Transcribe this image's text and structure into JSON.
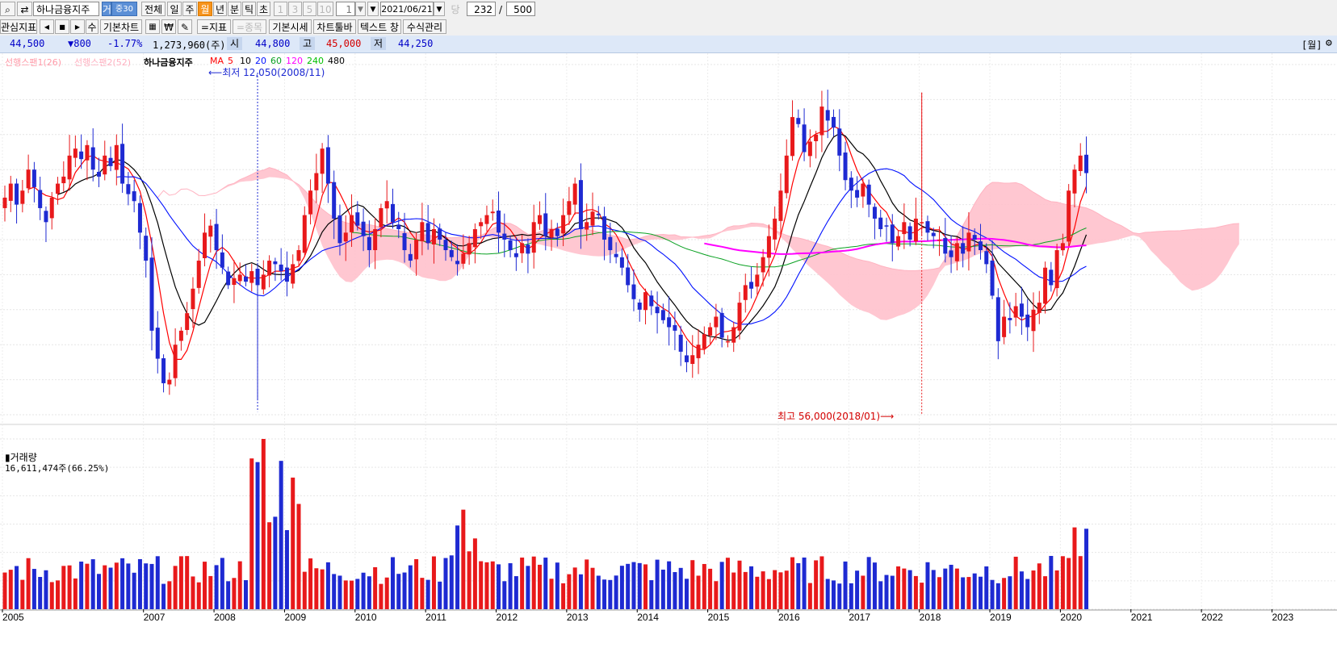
{
  "toolbar": {
    "stock_name": "하나금융지주",
    "badge_trade": "거",
    "badge_group": "중30",
    "periods": [
      "전체",
      "일",
      "주",
      "월",
      "년",
      "분",
      "틱",
      "초"
    ],
    "period_active": "월",
    "interval_buttons": [
      "1",
      "3",
      "5",
      "10"
    ],
    "interval_value": "1",
    "date": "2021/06/21",
    "count_label": "당",
    "count_value": "232",
    "count_sep": "/",
    "count_total": "500"
  },
  "toolbar2": {
    "interest": "관심지표",
    "nav": [
      "◀",
      "■",
      "▶"
    ],
    "su": "수",
    "basic_chart": "기본차트",
    "won": "₩",
    "indicator": "=지표",
    "stock": "=종목",
    "basic_quote": "기본시세",
    "chart_toolbar": "차트툴바",
    "text_window": "텍스트 창",
    "formula": "수식관리"
  },
  "quote": {
    "price": "44,500",
    "change": "▼800",
    "change_pct": "-1.77%",
    "volume": "1,273,960(주)",
    "open_label": "시",
    "open": "44,800",
    "high_label": "고",
    "high": "45,000",
    "low_label": "저",
    "low": "44,250",
    "period_tag": "[월]"
  },
  "legend": {
    "span1": "선행스팬1(26)",
    "span2": "선행스팬2(52)",
    "name": "하나금융지주",
    "ma_label": "MA",
    "ma_periods": [
      "5",
      "10",
      "20",
      "60",
      "120",
      "240",
      "480"
    ]
  },
  "colors": {
    "up": "#e8191b",
    "down": "#1e2ad2",
    "ma5": "#ff0000",
    "ma10": "#000000",
    "ma20": "#0010ff",
    "ma60": "#08a020",
    "ma120": "#ff00ff",
    "ma240": "#00c000",
    "ma480": "#000000",
    "cloud": "#ffc1cc",
    "span1": "#ff8fa3",
    "span2": "#ffb3c1"
  },
  "annotations": {
    "low": "최저 12,050(2008/11)",
    "high": "최고 56,000(2018/01)"
  },
  "volume": {
    "title": "거래량",
    "value": "16,611,474주(66.25%)"
  },
  "chart_data": {
    "type": "candlestick",
    "interval": "monthly",
    "xaxis_labels": [
      "2005",
      "2007",
      "2008",
      "2009",
      "2010",
      "2011",
      "2012",
      "2013",
      "2014",
      "2015",
      "2016",
      "2017",
      "2018",
      "2019",
      "2020",
      "2021",
      "2022",
      "2023"
    ],
    "price_range": [
      10000,
      60000
    ],
    "closes": [
      41000,
      43000,
      40000,
      42000,
      45000,
      42500,
      39500,
      37500,
      41000,
      43000,
      44000,
      47000,
      48000,
      46500,
      48500,
      45000,
      44000,
      47000,
      45500,
      48500,
      43000,
      41500,
      40500,
      36000,
      32000,
      22000,
      18000,
      14500,
      15000,
      20000,
      22000,
      24500,
      28000,
      32000,
      36000,
      37000,
      33500,
      31000,
      28500,
      29500,
      30000,
      29000,
      30500,
      28500,
      30000,
      32000,
      31500,
      30500,
      29000,
      31500,
      33500,
      38500,
      42000,
      44500,
      48000,
      43000,
      38000,
      34500,
      36000,
      38500,
      37000,
      35500,
      33500,
      36500,
      39500,
      40500,
      37500,
      36500,
      33500,
      32000,
      35000,
      37500,
      34500,
      36500,
      35000,
      33500,
      32500,
      31500,
      33000,
      34500,
      36500,
      37500,
      38500,
      39000,
      36000,
      35000,
      33500,
      32500,
      34500,
      33000,
      37500,
      38500,
      35500,
      36500,
      35500,
      38500,
      40500,
      43000,
      36500,
      37500,
      39000,
      38500,
      35000,
      33500,
      32500,
      31000,
      28500,
      26500,
      25000,
      27500,
      25500,
      24500,
      23500,
      22500,
      22000,
      19000,
      17500,
      18500,
      20000,
      21500,
      22500,
      24000,
      21000,
      20500,
      22500,
      26000,
      28500,
      28000,
      30000,
      32500,
      35500,
      38000,
      42000,
      47000,
      52500,
      51500,
      47500,
      49000,
      50000,
      54000,
      52000,
      51000,
      47000,
      43500,
      42000,
      41000,
      43000,
      40000,
      38000,
      36500,
      37000,
      34500,
      35500,
      37500,
      35000,
      38000,
      37500,
      36000,
      35500,
      35000,
      33000,
      32500,
      34500,
      33000,
      36000,
      35000,
      33500,
      31500,
      27000,
      20500,
      24000,
      23500,
      25500,
      24000,
      22500,
      25000,
      26000,
      31000,
      28500,
      33500,
      34500,
      42000,
      45000,
      47000,
      44500
    ]
  }
}
